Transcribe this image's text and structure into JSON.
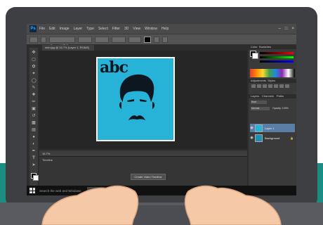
{
  "menubar": {
    "app_icon": "Ps",
    "items": [
      "File",
      "Edit",
      "Image",
      "Layer",
      "Type",
      "Select",
      "Filter",
      "3D",
      "View",
      "Window",
      "Help"
    ]
  },
  "window_controls": [
    "minimize-icon",
    "maximize-icon",
    "close-icon"
  ],
  "options_bar": {
    "font_family": "Bernard MT Con..."
  },
  "document": {
    "tab_title": "ninh.jpg @ 16.7% (Layer 1, RGB/8)",
    "artwork_text": "abc",
    "zoom_status": "16.7%"
  },
  "timeline": {
    "label": "Timeline",
    "create_button": "Create Video Timeline"
  },
  "panels": {
    "color_tab": "Color",
    "swatches_tab": "Swatches",
    "adjustments_tab": "Adjustments",
    "styles_tab": "Styles",
    "layers_tabs": [
      "Layers",
      "Channels",
      "Paths"
    ],
    "kind_filter": "Kind",
    "blend_mode": "Normal",
    "opacity_label": "Opacity: 100%",
    "layers": [
      {
        "name": "Layer 1",
        "selected": true
      },
      {
        "name": "Background",
        "selected": false
      }
    ]
  },
  "taskbar": {
    "search_placeholder": "Search the web and Windows"
  },
  "colors": {
    "artwork_background": "#27b3d7",
    "teal_backdrop": "#1a8d82",
    "selected_layer": "#5b7ea6"
  }
}
